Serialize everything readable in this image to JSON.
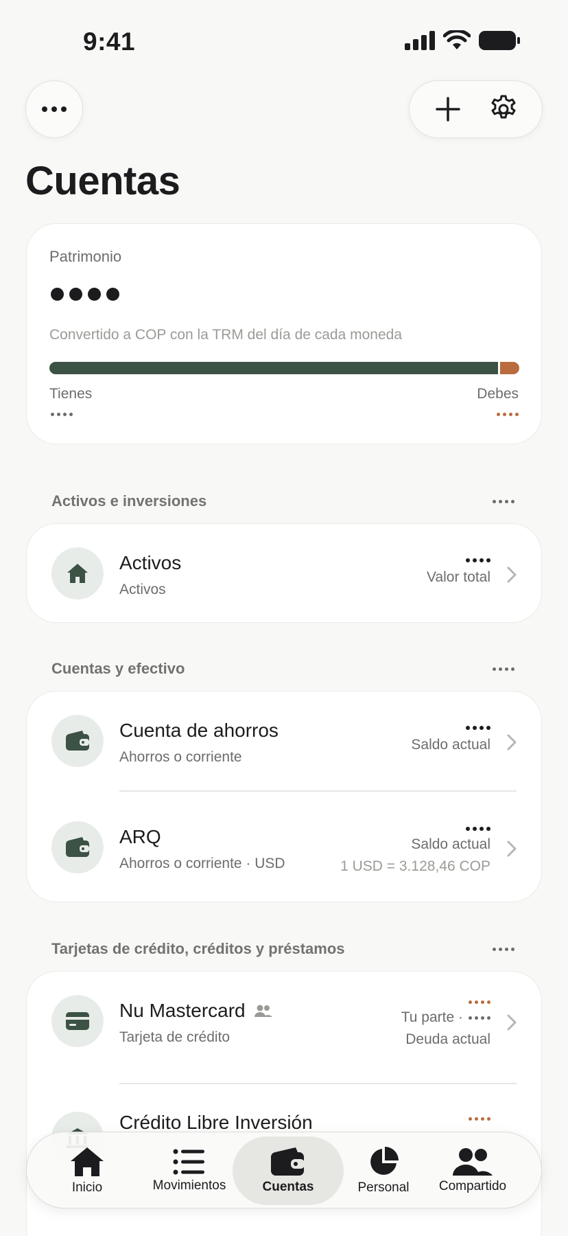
{
  "status": {
    "time": "9:41"
  },
  "header": {
    "title": "Cuentas"
  },
  "patrimonio": {
    "label": "Patrimonio",
    "note": "Convertido a COP con la TRM del día de cada moneda",
    "tienes_label": "Tienes",
    "debes_label": "Debes",
    "tienes_fraction": 0.955
  },
  "sections": {
    "activos": {
      "title": "Activos e inversiones",
      "rows": [
        {
          "title": "Activos",
          "subtitle": "Activos",
          "value_label": "Valor total"
        }
      ]
    },
    "cuentas": {
      "title": "Cuentas y efectivo",
      "rows": [
        {
          "title": "Cuenta de ahorros",
          "subtitle": "Ahorros o corriente",
          "value_label": "Saldo actual"
        },
        {
          "title": "ARQ",
          "subtitle": "Ahorros o corriente · USD",
          "value_label": "Saldo actual",
          "rate": "1 USD = 3.128,46 COP"
        }
      ]
    },
    "creditos": {
      "title": "Tarjetas de crédito, créditos y préstamos",
      "rows": [
        {
          "title": "Nu Mastercard",
          "subtitle": "Tarjeta de crédito",
          "share_label": "Tu parte ·",
          "value_label": "Deuda actual"
        },
        {
          "title": "Crédito Libre Inversión"
        }
      ]
    }
  },
  "tabs": [
    {
      "label": "Inicio",
      "icon": "home-icon"
    },
    {
      "label": "Movimientos",
      "icon": "list-icon"
    },
    {
      "label": "Cuentas",
      "icon": "wallet-icon",
      "active": true
    },
    {
      "label": "Personal",
      "icon": "pie-chart-icon"
    },
    {
      "label": "Compartido",
      "icon": "people-icon"
    }
  ],
  "colors": {
    "accent_green": "#3b5244",
    "debt_orange": "#b96c3e"
  }
}
